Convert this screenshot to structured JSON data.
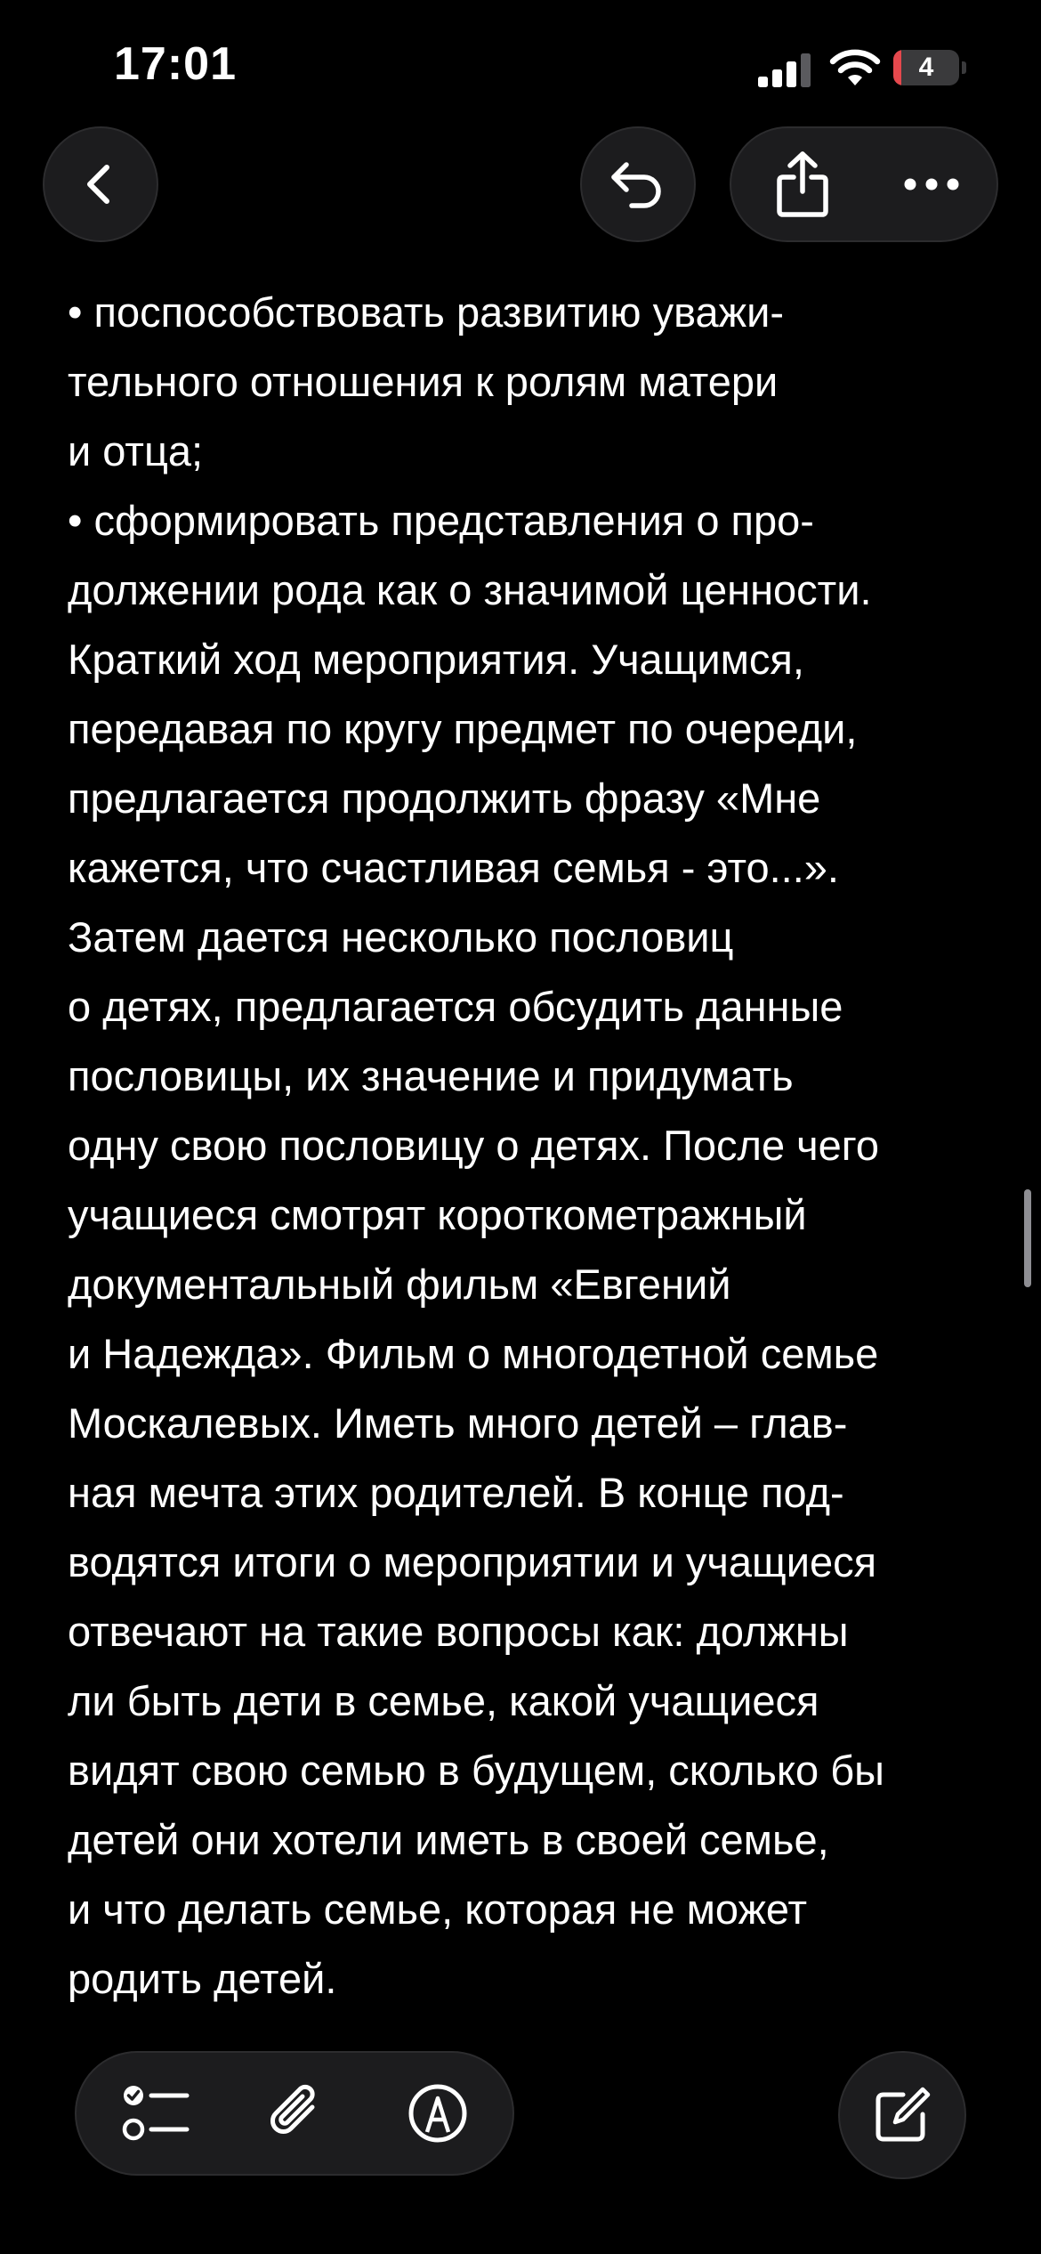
{
  "status_bar": {
    "time": "17:01",
    "battery_level": "4",
    "battery_fraction": 0.04,
    "battery_color": "#e5484d",
    "icons": [
      "signal-icon",
      "wifi-icon",
      "battery-icon"
    ]
  },
  "nav": {
    "icons": [
      "chevron-left-icon",
      "undo-icon",
      "share-icon",
      "ellipsis-icon"
    ]
  },
  "note": {
    "lines": [
      "• поспособствовать развитию уважи-",
      "тельного отношения к ролям матери",
      "и отца;",
      "• сформировать представления о про-",
      "должении рода как о значимой ценности.",
      "Краткий ход мероприятия. Учащимся,",
      "передавая по кругу предмет по очереди,",
      "предлагается продолжить фразу «Мне",
      "кажется, что счастливая семья - это...».",
      "Затем дается несколько пословиц",
      "о детях, предлагается обсудить данные",
      "пословицы, их значение и придумать",
      "одну свою пословицу о детях. После чего",
      "учащиеся смотрят короткометражный",
      "документальный фильм «Евгений",
      "и Надежда». Фильм о многодетной семье",
      "Москалевых. Иметь много детей – глав-",
      "ная мечта этих родителей. В конце под-",
      "водятся итоги о мероприятии и учащиеся",
      "отвечают на такие вопросы как: должны",
      "ли быть дети в семье, какой учащиеся",
      "видят свою семью в будущем, сколько бы",
      "детей они хотели иметь в своей семье,",
      "и что делать семье, которая не может",
      "родить детей."
    ]
  },
  "toolbar": {
    "icons": [
      "checklist-icon",
      "paperclip-icon",
      "markup-pen-icon",
      "compose-icon"
    ]
  },
  "colors": {
    "background": "#000000",
    "button_fill": "#1c1c1e",
    "text": "#ffffff"
  }
}
